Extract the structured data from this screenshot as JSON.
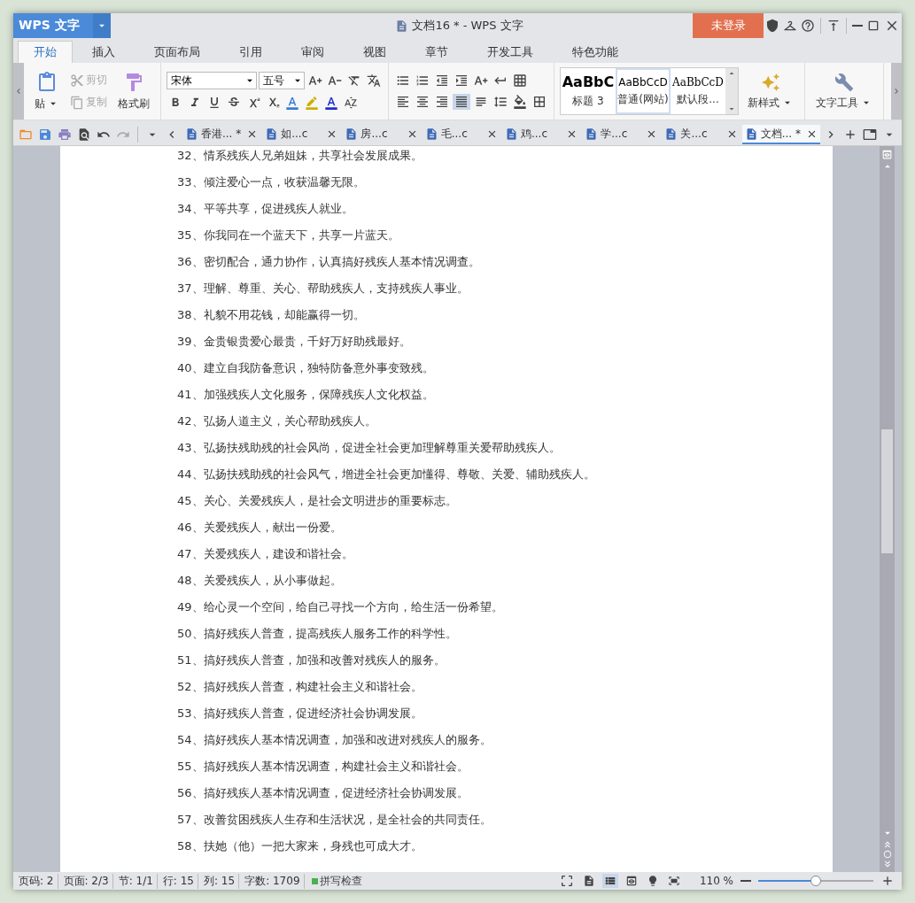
{
  "title_bar": {
    "app_button": "WPS 文字",
    "title": "文档16 * - WPS 文字",
    "login_button": "未登录"
  },
  "menu_tabs": [
    {
      "label": "开始",
      "selected": true
    },
    {
      "label": "插入",
      "selected": false
    },
    {
      "label": "页面布局",
      "selected": false
    },
    {
      "label": "引用",
      "selected": false
    },
    {
      "label": "审阅",
      "selected": false
    },
    {
      "label": "视图",
      "selected": false
    },
    {
      "label": "章节",
      "selected": false
    },
    {
      "label": "开发工具",
      "selected": false
    },
    {
      "label": "特色功能",
      "selected": false
    }
  ],
  "ribbon": {
    "paste": "贴",
    "clipboard_items": [
      {
        "label": "剪切",
        "disabled": true,
        "kind": "cut"
      },
      {
        "label": "复制",
        "disabled": true,
        "kind": "copy"
      }
    ],
    "format_painter": "格式刷",
    "font_name": "宋体",
    "font_size": "五号",
    "styles": [
      {
        "preview": "AaBbC",
        "label": "标题 3",
        "selected": false,
        "kind": "heading"
      },
      {
        "preview": "AaBbCcD",
        "label": "普通(网站)",
        "selected": true,
        "kind": "plain"
      },
      {
        "preview": "AaBbCcD",
        "label": "默认段...",
        "selected": false,
        "kind": "serif"
      }
    ],
    "new_style": "新样式",
    "text_tools": "文字工具"
  },
  "doc_tabs": [
    {
      "label": "香港... *",
      "selected": false
    },
    {
      "label": "如...c",
      "selected": false
    },
    {
      "label": "房...c",
      "selected": false
    },
    {
      "label": "毛...c",
      "selected": false
    },
    {
      "label": "鸡...c",
      "selected": false
    },
    {
      "label": "学...c",
      "selected": false
    },
    {
      "label": "关...c",
      "selected": false
    },
    {
      "label": "文档... *",
      "selected": true
    }
  ],
  "document": {
    "lines": [
      "32、情系残疾人兄弟姐妹，共享社会发展成果。",
      "33、倾注爱心一点，收获温馨无限。",
      "34、平等共享，促进残疾人就业。",
      "35、你我同在一个蓝天下，共享一片蓝天。",
      "36、密切配合，通力协作，认真搞好残疾人基本情况调查。",
      "37、理解、尊重、关心、帮助残疾人，支持残疾人事业。",
      "38、礼貌不用花钱，却能赢得一切。",
      "39、金贵银贵爱心最贵，千好万好助残最好。",
      "40、建立自我防备意识，独特防备意外事变致残。",
      "41、加强残疾人文化服务，保障残疾人文化权益。",
      "42、弘扬人道主义，关心帮助残疾人。",
      "43、弘扬扶残助残的社会风尚，促进全社会更加理解尊重关爱帮助残疾人。",
      "44、弘扬扶残助残的社会风气，增进全社会更加懂得、尊敬、关爱、辅助残疾人。",
      "45、关心、关爱残疾人，是社会文明进步的重要标志。",
      "46、关爱残疾人，献出一份爱。",
      "47、关爱残疾人，建设和谐社会。",
      "48、关爱残疾人，从小事做起。",
      "49、给心灵一个空间，给自己寻找一个方向，给生活一份希望。",
      "50、搞好残疾人普查，提高残疾人服务工作的科学性。",
      "51、搞好残疾人普查，加强和改善对残疾人的服务。",
      "52、搞好残疾人普查，构建社会主义和谐社会。",
      "53、搞好残疾人普查，促进经济社会协调发展。",
      "54、搞好残疾人基本情况调查，加强和改进对残疾人的服务。",
      "55、搞好残疾人基本情况调查，构建社会主义和谐社会。",
      "56、搞好残疾人基本情况调查，促进经济社会协调发展。",
      "57、改善贫困残疾人生存和生活状况，是全社会的共同责任。",
      "58、扶她（他）一把大家来，身残也可成大才。"
    ]
  },
  "status_bar": {
    "fields": [
      "页码: 2",
      "页面: 2/3",
      "节: 1/1",
      "行: 15",
      "列: 15",
      "字数: 1709"
    ],
    "spell_check": "拼写检查",
    "view_modes": [
      {
        "selected": false
      },
      {
        "selected": true
      },
      {
        "selected": false
      },
      {
        "selected": false
      },
      {
        "selected": false
      }
    ],
    "zoom": "110 %",
    "zoom_slider": {
      "level": 0.5
    }
  }
}
